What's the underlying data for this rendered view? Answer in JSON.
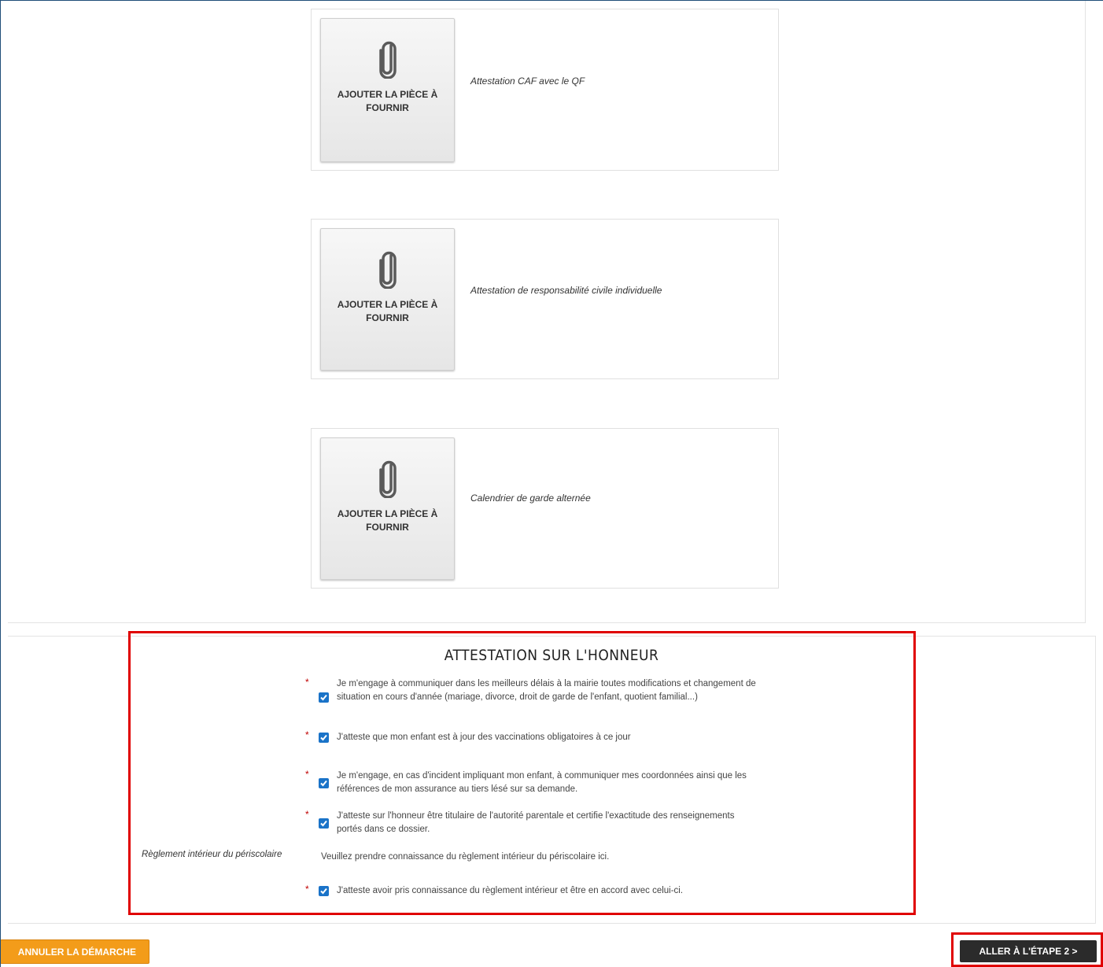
{
  "documents": [
    {
      "button_label": "AJOUTER LA PIÈCE À FOURNIR",
      "title": "Attestation CAF avec le QF"
    },
    {
      "button_label": "AJOUTER LA PIÈCE À FOURNIR",
      "title": "Attestation de responsabilité civile individuelle"
    },
    {
      "button_label": "AJOUTER LA PIÈCE À FOURNIR",
      "title": "Calendrier de garde alternée"
    }
  ],
  "attestation": {
    "title": "ATTESTATION SUR L'HONNEUR",
    "required_mark": "*",
    "items": [
      {
        "text": "Je m'engage à communiquer dans les meilleurs délais à la mairie toutes modifications et changement de situation en cours d'année (mariage, divorce, droit de garde de l'enfant, quotient familial...)",
        "checked": true
      },
      {
        "text": "J'atteste que mon enfant est à jour des vaccinations obligatoires à ce jour",
        "checked": true
      },
      {
        "text": "Je m'engage, en cas d'incident impliquant mon enfant, à communiquer mes coordonnées ainsi que les références de mon assurance au tiers lésé sur sa demande.",
        "checked": true
      },
      {
        "text": "J'atteste sur l'honneur être titulaire de l'autorité parentale et certifie l'exactitude des renseignements portés dans ce dossier.",
        "checked": true
      },
      {
        "text": "J'atteste avoir pris connaissance du règlement intérieur et être en accord avec celui-ci.",
        "checked": true
      }
    ],
    "reglement": {
      "label": "Règlement intérieur du périscolaire",
      "text_before": "Veuillez prendre connaissance du règlement intérieur du périscolaire ",
      "link": "ici",
      "text_after": "."
    }
  },
  "footer": {
    "cancel_label": "ANNULER LA DÉMARCHE",
    "next_label": "ALLER À L'ÉTAPE 2 >"
  },
  "colors": {
    "cancel": "#f39c1a",
    "next": "#2b2b2b",
    "checkbox": "#1a73c8",
    "highlight": "#e00000"
  }
}
